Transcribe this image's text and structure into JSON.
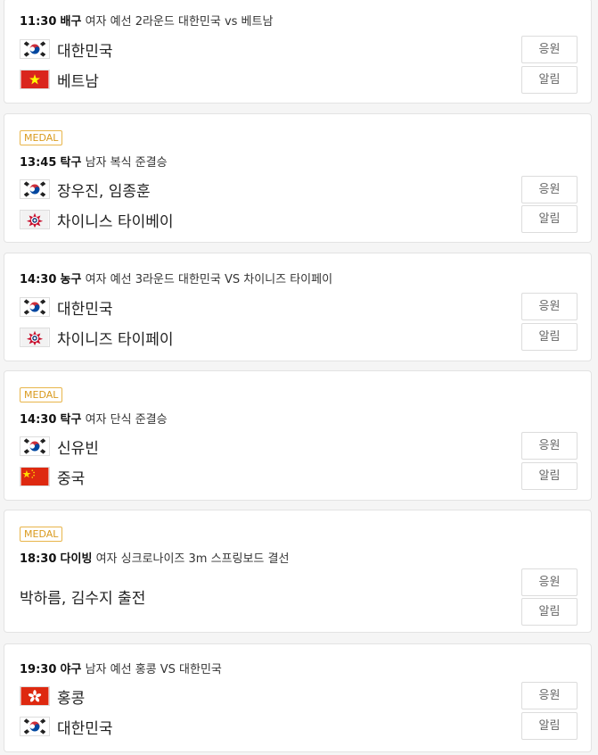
{
  "events": [
    {
      "medal": "",
      "time": "11:30",
      "sport": "배구",
      "title": "여자 예선 2라운드 대한민국 vs 베트남",
      "entries": [
        {
          "flag": "korea-flag-icon",
          "name": "대한민국"
        },
        {
          "flag": "vietnam-flag-icon",
          "name": "베트남"
        }
      ],
      "cheer_label": "응원",
      "alarm_label": "알림"
    },
    {
      "medal": "MEDAL",
      "time": "13:45",
      "sport": "탁구",
      "title": "남자 복식 준결승",
      "entries": [
        {
          "flag": "korea-flag-icon",
          "name": "장우진, 임종훈"
        },
        {
          "flag": "chinese-taipei-flag-icon",
          "name": "차이니스 타이베이"
        }
      ],
      "cheer_label": "응원",
      "alarm_label": "알림"
    },
    {
      "medal": "",
      "time": "14:30",
      "sport": "농구",
      "title": "여자 예선 3라운드 대한민국 VS 차이니즈 타이페이",
      "entries": [
        {
          "flag": "korea-flag-icon",
          "name": "대한민국"
        },
        {
          "flag": "chinese-taipei-flag-icon",
          "name": "차이니즈 타이페이"
        }
      ],
      "cheer_label": "응원",
      "alarm_label": "알림"
    },
    {
      "medal": "MEDAL",
      "time": "14:30",
      "sport": "탁구",
      "title": "여자 단식 준결승",
      "entries": [
        {
          "flag": "korea-flag-icon",
          "name": "신유빈"
        },
        {
          "flag": "china-flag-icon",
          "name": "중국"
        }
      ],
      "cheer_label": "응원",
      "alarm_label": "알림"
    },
    {
      "medal": "MEDAL",
      "time": "18:30",
      "sport": "다이빙",
      "title": "여자 싱크로나이즈 3m 스프링보드 결선",
      "entries": [
        {
          "flag": "",
          "name": "박하름, 김수지 출전"
        }
      ],
      "cheer_label": "응원",
      "alarm_label": "알림"
    },
    {
      "medal": "",
      "time": "19:30",
      "sport": "야구",
      "title": "남자 예선 홍콩 VS 대한민국",
      "entries": [
        {
          "flag": "hong-kong-flag-icon",
          "name": "홍콩"
        },
        {
          "flag": "korea-flag-icon",
          "name": "대한민국"
        }
      ],
      "cheer_label": "응원",
      "alarm_label": "알림"
    }
  ]
}
